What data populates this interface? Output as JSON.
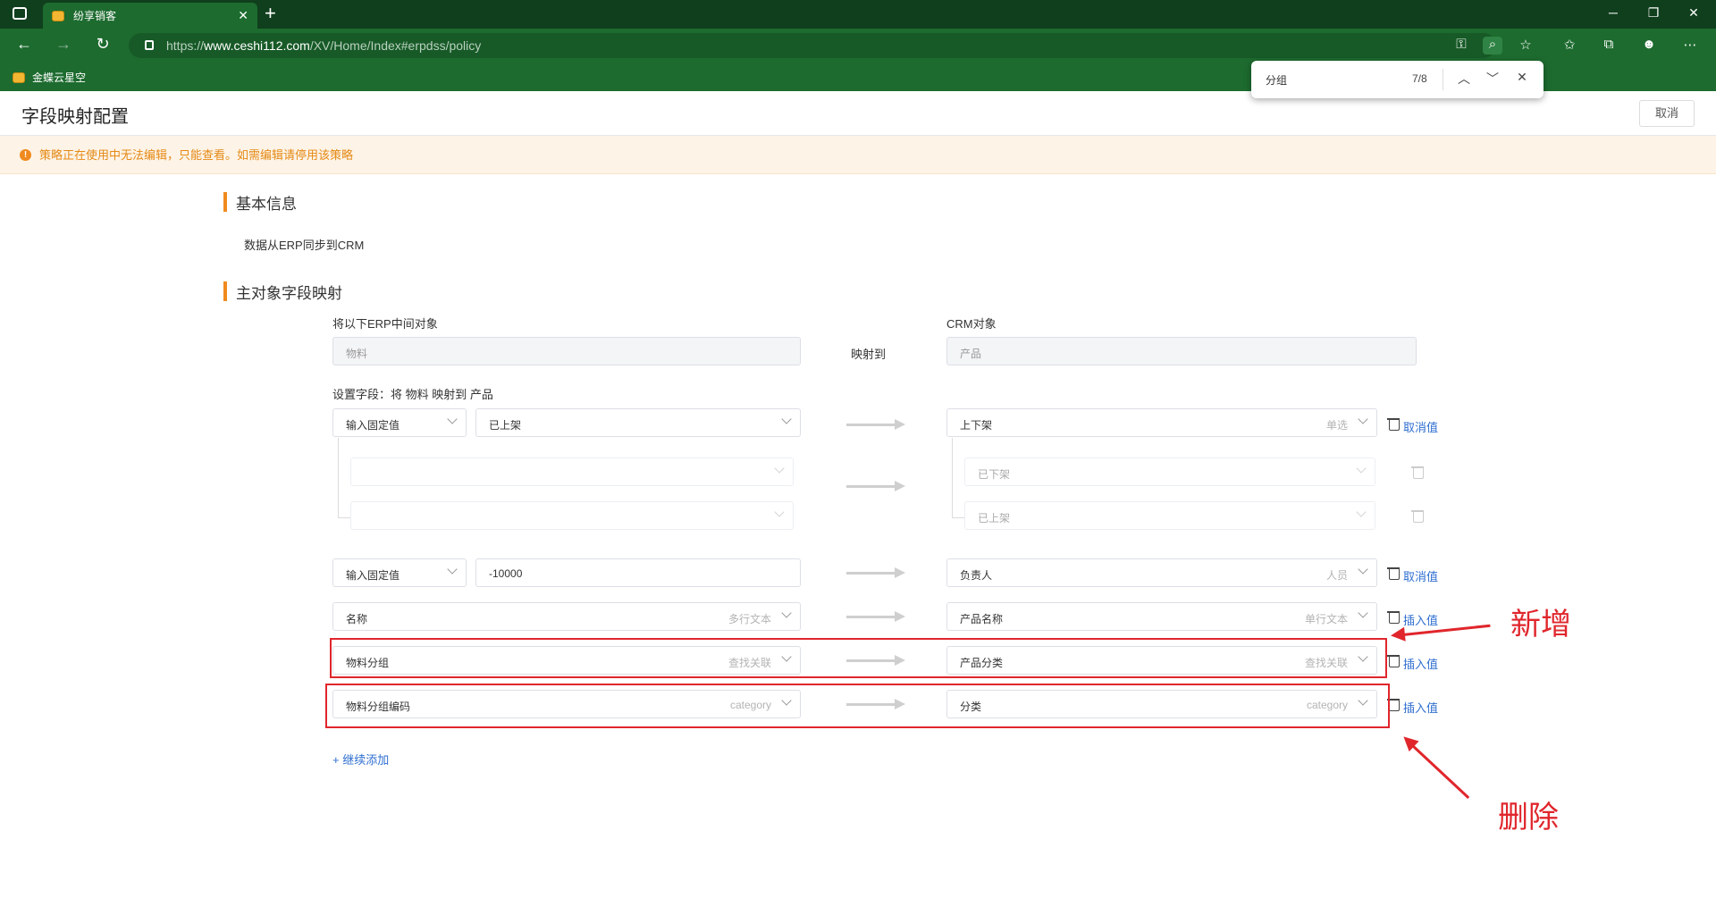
{
  "browser": {
    "tab_title": "纷享销客",
    "url_prefix": "https://",
    "url_host": "www.ceshi112.com",
    "url_path": "/XV/Home/Index#erpdss/policy",
    "favorite": "金蝶云星空"
  },
  "find": {
    "query": "分组",
    "count": "7/8"
  },
  "page": {
    "title": "字段映射配置",
    "cancel_label": "取消",
    "warning": "策略正在使用中无法编辑，只能查看。如需编辑请停用该策略",
    "section_basic": "基本信息",
    "sync_desc": "数据从ERP同步到CRM",
    "section_main": "主对象字段映射",
    "erp_label": "将以下ERP中间对象",
    "crm_label": "CRM对象",
    "erp_object": "物料",
    "crm_object": "产品",
    "maps_to": "映射到",
    "fields_label": "设置字段：将 物料 映射到 产品",
    "add_more": "+ 继续添加"
  },
  "rows": {
    "r1": {
      "type": "输入固定值",
      "value": "已上架",
      "crm": "上下架",
      "crm_hint": "单选",
      "action": "取消值",
      "sub1_crm": "已下架",
      "sub2_crm": "已上架"
    },
    "r2": {
      "type": "输入固定值",
      "value": "-10000",
      "crm": "负责人",
      "crm_hint": "人员",
      "action": "取消值"
    },
    "r3": {
      "erp": "名称",
      "erp_hint": "多行文本",
      "crm": "产品名称",
      "crm_hint": "单行文本",
      "action": "插入值"
    },
    "r4": {
      "erp": "物料分组",
      "erp_hint": "查找关联",
      "crm": "产品分类",
      "crm_hint": "查找关联",
      "action": "插入值"
    },
    "r5": {
      "erp": "物料分组编码",
      "erp_hint": "category",
      "crm": "分类",
      "crm_hint": "category",
      "action": "插入值"
    }
  },
  "annotations": {
    "add": "新增",
    "delete": "删除",
    "color": "#e0262c"
  }
}
